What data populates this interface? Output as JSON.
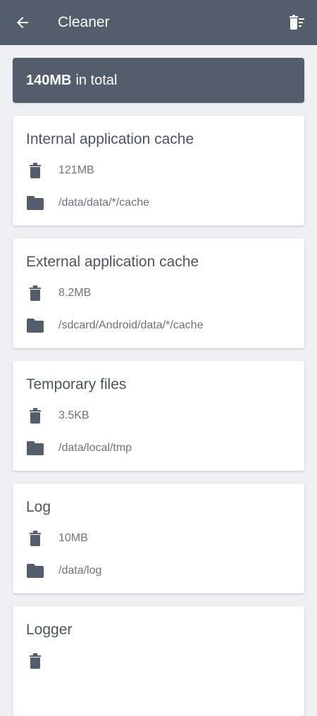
{
  "appbar": {
    "title": "Cleaner",
    "back_icon": "arrow-left-icon",
    "action_icon": "delete-sweep-icon"
  },
  "total": {
    "amount": "140MB",
    "suffix": "in total"
  },
  "cards": [
    {
      "title": "Internal application cache",
      "size": "121MB",
      "path": "/data/data/*/cache"
    },
    {
      "title": "External application cache",
      "size": "8.2MB",
      "path": "/sdcard/Android/data/*/cache"
    },
    {
      "title": "Temporary files",
      "size": "3.5KB",
      "path": "/data/local/tmp"
    },
    {
      "title": "Log",
      "size": "10MB",
      "path": "/data/log"
    },
    {
      "title": "Logger",
      "size": "",
      "path": ""
    }
  ],
  "colors": {
    "primary": "#545d6b",
    "background": "#eef0f4",
    "card": "#ffffff",
    "icon": "#545d6b"
  }
}
